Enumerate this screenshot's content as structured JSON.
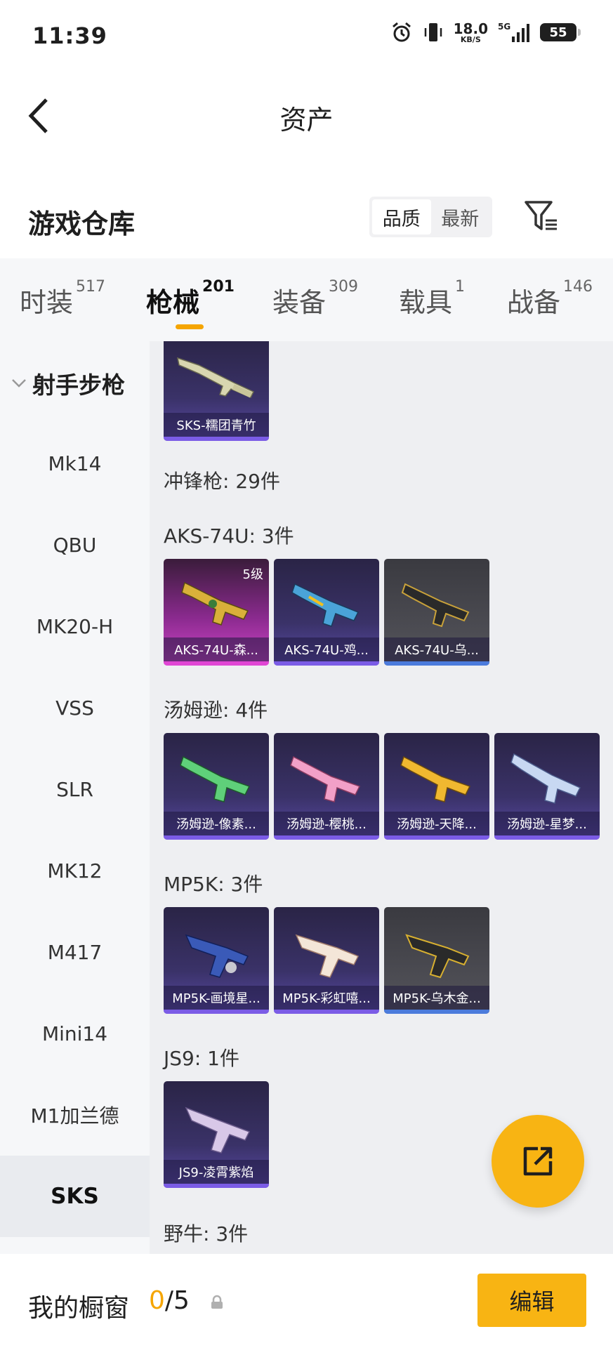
{
  "status_bar": {
    "time": "11:39",
    "net_speed": "18.0",
    "net_unit": "KB/S",
    "signal": "5G",
    "battery": "55"
  },
  "header": {
    "title": "资产"
  },
  "section": {
    "title": "游戏仓库",
    "sort_quality": "品质",
    "sort_latest": "最新",
    "active_sort": "品质"
  },
  "tabs": [
    {
      "label": "时装",
      "count": "517"
    },
    {
      "label": "枪械",
      "count": "201"
    },
    {
      "label": "装备",
      "count": "309"
    },
    {
      "label": "载具",
      "count": "1"
    },
    {
      "label": "战备",
      "count": "146"
    }
  ],
  "active_tab": "枪械",
  "sidebar": {
    "group": "射手步枪",
    "items": [
      "Mk14",
      "QBU",
      "MK20-H",
      "VSS",
      "SLR",
      "MK12",
      "M417",
      "Mini14",
      "M1加兰德",
      "SKS"
    ],
    "active": "SKS"
  },
  "content": {
    "top_card": {
      "name": "SKS-糯团青竹"
    },
    "category_label": "冲锋枪: 29件",
    "groups": [
      {
        "label": "AKS-74U: 3件",
        "cards": [
          {
            "name": "AKS-74U-森...",
            "level": "5级"
          },
          {
            "name": "AKS-74U-鸡..."
          },
          {
            "name": "AKS-74U-乌..."
          }
        ]
      },
      {
        "label": "汤姆逊: 4件",
        "cards": [
          {
            "name": "汤姆逊-像素..."
          },
          {
            "name": "汤姆逊-樱桃..."
          },
          {
            "name": "汤姆逊-天降..."
          },
          {
            "name": "汤姆逊-星梦..."
          }
        ]
      },
      {
        "label": "MP5K: 3件",
        "cards": [
          {
            "name": "MP5K-画境星..."
          },
          {
            "name": "MP5K-彩虹嘻..."
          },
          {
            "name": "MP5K-乌木金..."
          }
        ]
      },
      {
        "label": "JS9: 1件",
        "cards": [
          {
            "name": "JS9-凌霄紫焰"
          }
        ]
      },
      {
        "label": "野牛: 3件",
        "cards": []
      }
    ]
  },
  "bottom": {
    "showcase_label": "我的橱窗",
    "current": "0",
    "total": "/5",
    "edit_label": "编辑"
  },
  "colors": {
    "accent": "#f8b413",
    "purple_rarity": "#7b5ce6",
    "pink_rarity": "#e046d4",
    "blue_rarity": "#4b7bdc"
  }
}
